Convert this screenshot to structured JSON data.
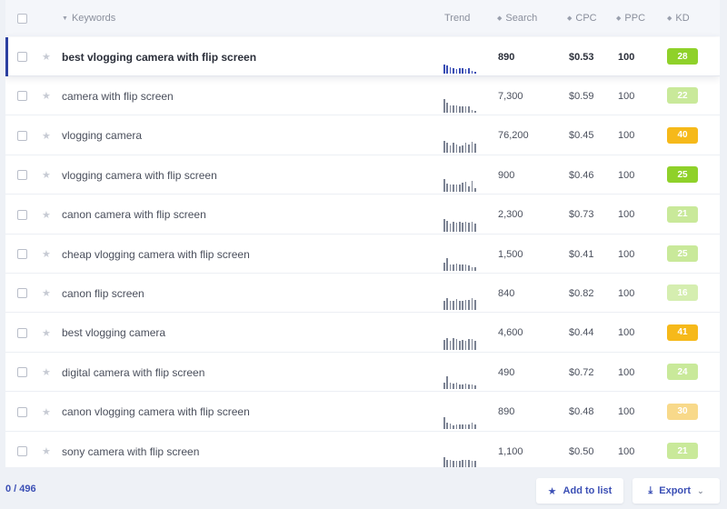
{
  "header": {
    "keywords": "Keywords",
    "trend": "Trend",
    "search": "Search",
    "cpc": "CPC",
    "ppc": "PPC",
    "kd": "KD"
  },
  "rows": [
    {
      "keyword": "best vlogging camera with flip screen",
      "search": "890",
      "cpc": "$0.53",
      "ppc": "100",
      "kd": "28",
      "kd_color": "#8fd12a",
      "trend": [
        10,
        9,
        7,
        6,
        5,
        6,
        6,
        5,
        6,
        3,
        2
      ]
    },
    {
      "keyword": "camera with flip screen",
      "search": "7,300",
      "cpc": "$0.59",
      "ppc": "100",
      "kd": "22",
      "kd_color": "#c9e99a",
      "trend": [
        15,
        11,
        8,
        8,
        8,
        7,
        7,
        7,
        7,
        3,
        2
      ]
    },
    {
      "keyword": "vlogging camera",
      "search": "76,200",
      "cpc": "$0.45",
      "ppc": "100",
      "kd": "40",
      "kd_color": "#f6b91a",
      "trend": [
        13,
        11,
        8,
        11,
        9,
        7,
        8,
        11,
        9,
        12,
        10
      ]
    },
    {
      "keyword": "vlogging camera with flip screen",
      "search": "900",
      "cpc": "$0.46",
      "ppc": "100",
      "kd": "25",
      "kd_color": "#8fd12a",
      "trend": [
        14,
        9,
        8,
        8,
        8,
        8,
        10,
        11,
        6,
        12,
        4
      ]
    },
    {
      "keyword": "canon camera with flip screen",
      "search": "2,300",
      "cpc": "$0.73",
      "ppc": "100",
      "kd": "21",
      "kd_color": "#c9e99a",
      "trend": [
        14,
        12,
        9,
        11,
        10,
        11,
        10,
        11,
        10,
        11,
        9
      ]
    },
    {
      "keyword": "cheap vlogging camera with flip screen",
      "search": "1,500",
      "cpc": "$0.41",
      "ppc": "100",
      "kd": "25",
      "kd_color": "#c9e99a",
      "trend": [
        9,
        14,
        7,
        7,
        8,
        7,
        7,
        7,
        6,
        4,
        4
      ]
    },
    {
      "keyword": "canon flip screen",
      "search": "840",
      "cpc": "$0.82",
      "ppc": "100",
      "kd": "16",
      "kd_color": "#d5eeb0",
      "trend": [
        10,
        13,
        10,
        10,
        12,
        10,
        10,
        11,
        11,
        13,
        11
      ]
    },
    {
      "keyword": "best vlogging camera",
      "search": "4,600",
      "cpc": "$0.44",
      "ppc": "100",
      "kd": "41",
      "kd_color": "#f6b91a",
      "trend": [
        11,
        13,
        10,
        13,
        12,
        10,
        11,
        10,
        12,
        12,
        10
      ]
    },
    {
      "keyword": "digital camera with flip screen",
      "search": "490",
      "cpc": "$0.72",
      "ppc": "100",
      "kd": "24",
      "kd_color": "#c9e99a",
      "trend": [
        7,
        14,
        7,
        6,
        7,
        5,
        5,
        6,
        5,
        5,
        4
      ]
    },
    {
      "keyword": "canon vlogging camera with flip screen",
      "search": "890",
      "cpc": "$0.48",
      "ppc": "100",
      "kd": "30",
      "kd_color": "#f8d98a",
      "trend": [
        13,
        7,
        6,
        4,
        5,
        5,
        5,
        5,
        5,
        7,
        5
      ]
    },
    {
      "keyword": "sony camera with flip screen",
      "search": "1,100",
      "cpc": "$0.50",
      "ppc": "100",
      "kd": "21",
      "kd_color": "#c9e99a",
      "trend": [
        12,
        9,
        9,
        8,
        8,
        8,
        9,
        9,
        9,
        8,
        8
      ]
    }
  ],
  "footer": {
    "count": "0 / 496",
    "add_to_list": "Add to list",
    "export": "Export"
  },
  "icons": {
    "sort": "sort-icon",
    "star": "star-icon",
    "add": "star-icon",
    "export": "download-icon",
    "chevron": "chevron-down-icon"
  },
  "colors": {
    "accent": "#3b4fb5",
    "active_marker": "#2b3fa0"
  }
}
